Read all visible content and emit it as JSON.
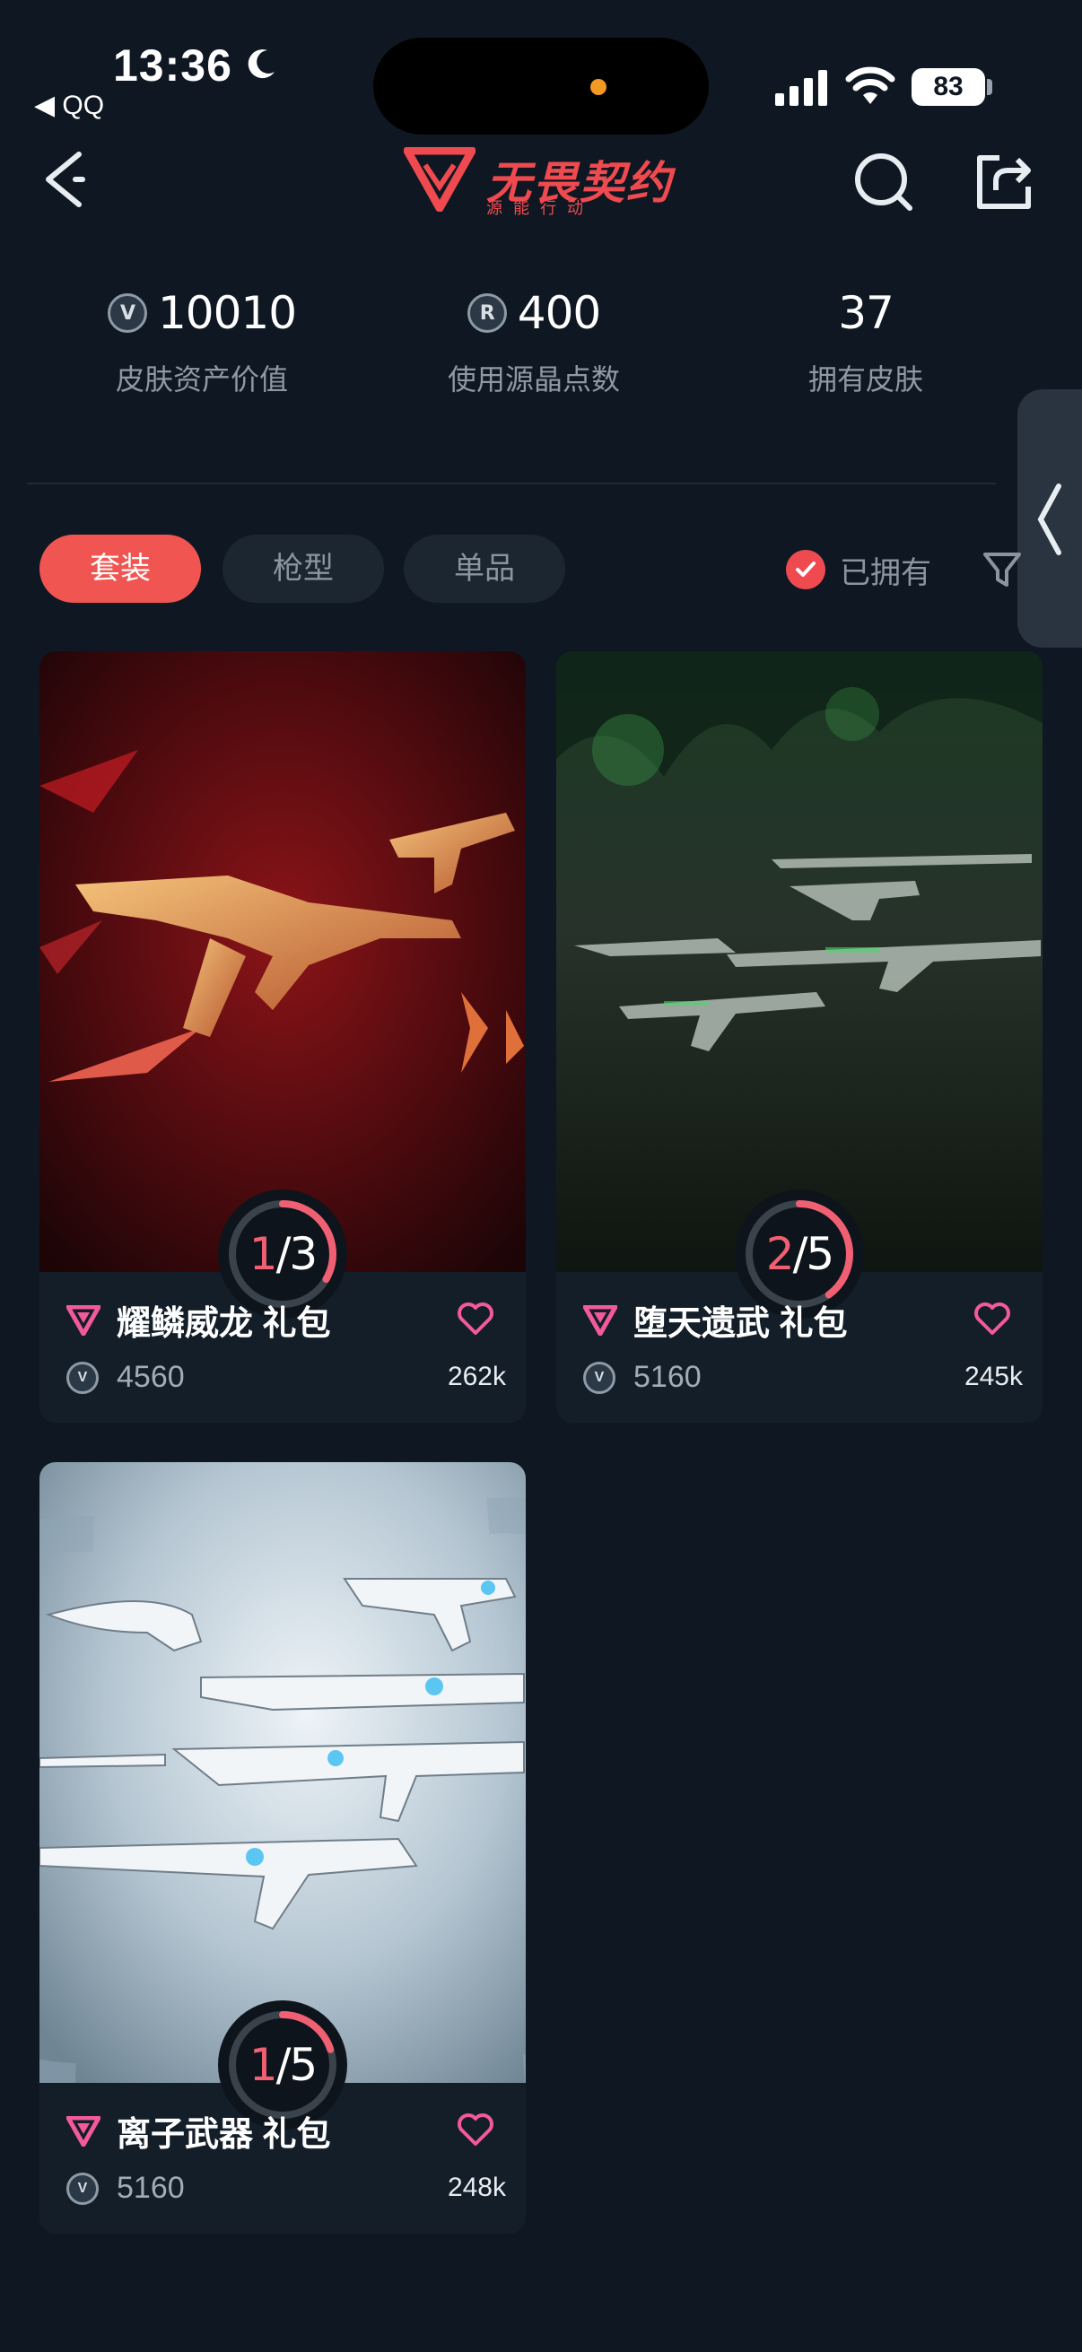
{
  "status_bar": {
    "time": "13:36",
    "back_app": "◀ QQ",
    "battery": "83"
  },
  "header": {
    "logo_title": "无畏契约",
    "logo_subtitle": "源能行动"
  },
  "stats": [
    {
      "value": "10010",
      "label": "皮肤资产价值",
      "icon": "vp-coin-icon"
    },
    {
      "value": "400",
      "label": "使用源晶点数",
      "icon": "radianite-icon"
    },
    {
      "value": "37",
      "label": "拥有皮肤",
      "icon": ""
    }
  ],
  "filters": {
    "tabs": [
      "套装",
      "枪型",
      "单品"
    ],
    "active_tab": "套装",
    "owned_label": "已拥有"
  },
  "colors": {
    "accent": "#ef4a4f",
    "background": "#0f1822",
    "card": "#141e29",
    "progress": "#f06072"
  },
  "bundles": [
    {
      "name": "耀鳞威龙 礼包",
      "price": "4560",
      "likes": "262k",
      "owned": "1",
      "total": "3",
      "progress": 0.3333,
      "theme": "red"
    },
    {
      "name": "堕天遗武 礼包",
      "price": "5160",
      "likes": "245k",
      "owned": "2",
      "total": "5",
      "progress": 0.4,
      "theme": "green"
    },
    {
      "name": "离子武器 礼包",
      "price": "5160",
      "likes": "248k",
      "owned": "1",
      "total": "5",
      "progress": 0.2,
      "theme": "ion"
    }
  ]
}
